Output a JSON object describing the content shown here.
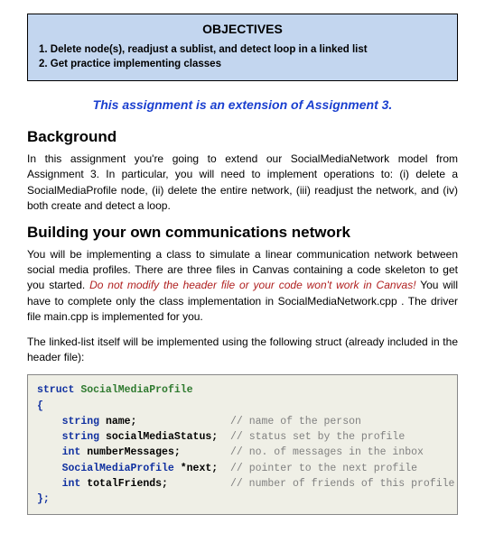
{
  "objectives": {
    "title": "OBJECTIVES",
    "item1": "1. Delete node(s), readjust a sublist, and detect loop in a linked list",
    "item2": "2. Get practice implementing classes"
  },
  "extension_note": "This assignment is an extension of Assignment 3.",
  "background": {
    "heading": "Background",
    "para": "In this assignment you're going to extend our SocialMediaNetwork model from Assignment 3. In particular, you will need to implement operations to: (i) delete a SocialMediaProfile node, (ii) delete the entire network, (iii) readjust the network, and (iv) both create and detect a loop."
  },
  "building": {
    "heading": "Building your own communications network",
    "para1_a": "You will be implementing a class to simulate a linear communication network between social media profiles. There are three files in Canvas containing a code skeleton to get you started. ",
    "para1_warn": "Do not modify the header file or your code won't work in Canvas!",
    "para1_b": " You will have to complete only the class implementation in SocialMediaNetwork.cpp . The driver file main.cpp is implemented for you.",
    "para2": "The linked-list itself will be implemented using the following struct (already included in the header file):"
  },
  "code": {
    "kw_struct": "struct",
    "type_name": "SocialMediaProfile",
    "brace_open": "{",
    "line1_type": "string",
    "line1_name": "name;",
    "line1_comment": "// name of the person",
    "line2_type": "string",
    "line2_name": "socialMediaStatus;",
    "line2_comment": "// status set by the profile",
    "line3_type": "int",
    "line3_name": "numberMessages;",
    "line3_comment": "// no. of messages in the inbox",
    "line4_type": "SocialMediaProfile",
    "line4_name": "*next;",
    "line4_comment": "// pointer to the next profile",
    "line5_type": "int",
    "line5_name": "totalFriends;",
    "line5_comment": "// number of friends of this profile",
    "brace_close": "};"
  }
}
